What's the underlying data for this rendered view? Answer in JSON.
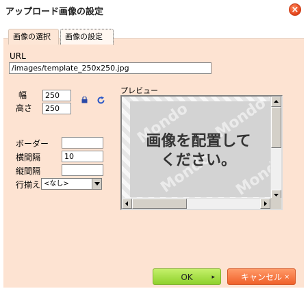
{
  "dialog": {
    "title": "アップロード画像の設定",
    "close_icon": "×"
  },
  "tabs": [
    {
      "label": "画像の選択"
    },
    {
      "label": "画像の設定"
    }
  ],
  "form": {
    "url_label": "URL",
    "url_value": "/images/template_250x250.jpg",
    "width_label": "幅",
    "width_value": "250",
    "height_label": "高さ",
    "height_value": "250",
    "border_label": "ボーダー",
    "border_value": "",
    "hspace_label": "横間隔",
    "hspace_value": "10",
    "vspace_label": "縦間隔",
    "vspace_value": "",
    "align_label": "行揃え",
    "align_selected": "<なし>"
  },
  "preview": {
    "label": "プレビュー",
    "placeholder_line1": "画像を配置して",
    "placeholder_line2": "ください。",
    "watermark": "Mondo"
  },
  "footer": {
    "ok_label": "OK",
    "cancel_label": "キャンセル",
    "ok_chevron": "▸",
    "cancel_chevron": "×"
  },
  "colors": {
    "panel_bg": "#fde3d2",
    "ok_button": "#8fd12c",
    "cancel_button": "#f0612a",
    "close_button": "#e2421a"
  },
  "icons": {
    "lock": "lock-icon",
    "reset": "refresh-icon"
  }
}
